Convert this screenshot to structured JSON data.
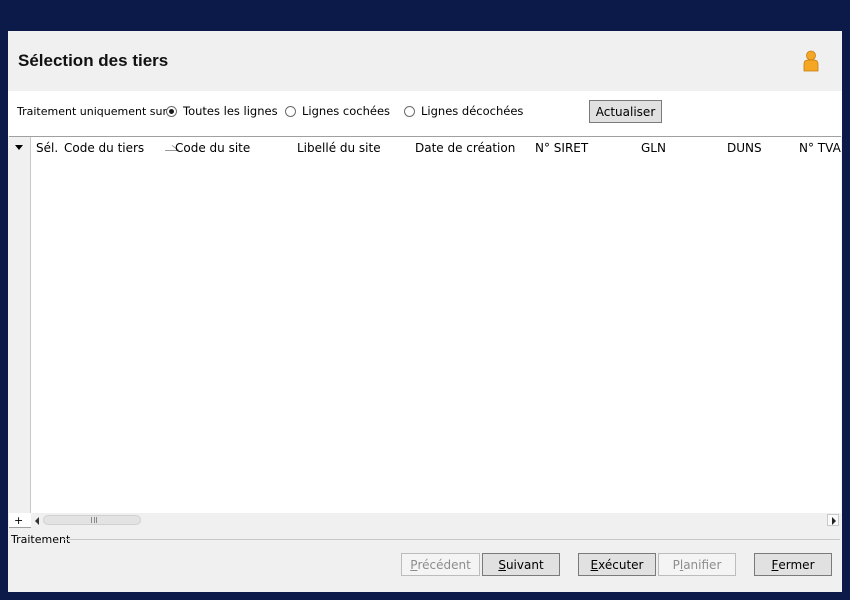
{
  "window": {
    "title": "Sélection des tiers"
  },
  "filter": {
    "label": "Traitement uniquement sur :",
    "options": [
      {
        "label": "Toutes les lignes",
        "selected": true
      },
      {
        "label": "Lignes cochées",
        "selected": false
      },
      {
        "label": "Lignes décochées",
        "selected": false
      }
    ],
    "refresh_label": "Actualiser"
  },
  "grid": {
    "columns": [
      "Sél.",
      "Code du tiers",
      "Code du site",
      "Libellé du site",
      "Date de création",
      "N° SIRET",
      "GLN",
      "DUNS",
      "N° TVA"
    ],
    "sorted_column": "Code du tiers",
    "rows": [],
    "add_label": "+"
  },
  "footer": {
    "section_label": "Traitement",
    "buttons": {
      "prev": {
        "first": "P",
        "rest": "récédent",
        "enabled": false
      },
      "next": {
        "first": "S",
        "rest": "uivant",
        "enabled": true
      },
      "run": {
        "first": "E",
        "rest": "xécuter",
        "enabled": true
      },
      "plan_before": "P",
      "plan_u": "l",
      "plan_after": "anifier",
      "plan_enabled": false,
      "close": {
        "first": "F",
        "rest": "ermer",
        "enabled": true
      }
    }
  },
  "icons": {
    "user": "user-icon",
    "menu": "grid-menu-icon"
  },
  "colors": {
    "desktop": "#0b1a48",
    "panel": "#f0f0f0",
    "user_icon": "#f5a623"
  }
}
